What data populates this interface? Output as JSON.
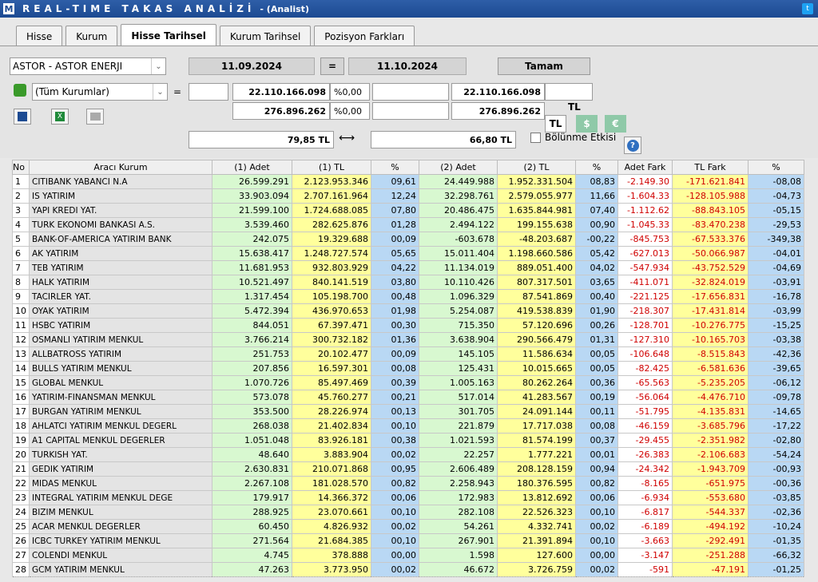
{
  "app": {
    "logo": "M",
    "title": "REAL-TIME TAKAS ANALİZİ",
    "subtitle": "- (Analist)"
  },
  "tabs": [
    "Hisse",
    "Kurum",
    "Hisse Tarihsel",
    "Kurum Tarihsel",
    "Pozisyon Farkları"
  ],
  "controls": {
    "stock": "ASTOR - ASTOR ENERJI",
    "date_start": "11.09.2024",
    "equals": "=",
    "date_end": "11.10.2024",
    "ok_button": "Tamam",
    "institution": "(Tüm Kurumlar)",
    "eq2": "=",
    "total1": "22.110.166.098",
    "pct1": "%0,00",
    "total2": "22.110.166.098",
    "lot1": "276.896.262",
    "pct2": "%0,00",
    "lot2": "276.896.262",
    "tl_label": "TL",
    "cur_tl": "TL",
    "cur_usd": "$",
    "cur_eur": "€",
    "price1": "79,85 TL",
    "arrow": "⟷",
    "price2": "66,80 TL",
    "split_label": "Bölünme Etkisi",
    "help": "?"
  },
  "colors": {
    "titlebar": "#1c4a92",
    "green": "#d8f8d0",
    "yellow": "#ffff9c",
    "blue": "#b9d8f4",
    "negative": "#d00000"
  },
  "table": {
    "headers": [
      "No",
      "Aracı Kurum",
      "(1) Adet",
      "(1) TL",
      "%",
      "(2) Adet",
      "(2) TL",
      "%",
      "Adet Fark",
      "TL Fark",
      "%"
    ],
    "rows": [
      [
        "1",
        "CITIBANK YABANCI N.A",
        "26.599.291",
        "2.123.953.346",
        "09,61",
        "24.449.988",
        "1.952.331.504",
        "08,83",
        "-2.149.30",
        "-171.621.841",
        "-08,08"
      ],
      [
        "2",
        "IS YATIRIM",
        "33.903.094",
        "2.707.161.964",
        "12,24",
        "32.298.761",
        "2.579.055.977",
        "11,66",
        "-1.604.33",
        "-128.105.988",
        "-04,73"
      ],
      [
        "3",
        "YAPI KREDI YAT.",
        "21.599.100",
        "1.724.688.085",
        "07,80",
        "20.486.475",
        "1.635.844.981",
        "07,40",
        "-1.112.62",
        "-88.843.105",
        "-05,15"
      ],
      [
        "4",
        "TURK EKONOMI BANKASI A.S.",
        "3.539.460",
        "282.625.876",
        "01,28",
        "2.494.122",
        "199.155.638",
        "00,90",
        "-1.045.33",
        "-83.470.238",
        "-29,53"
      ],
      [
        "5",
        "BANK-OF-AMERICA YATIRIM BANK",
        "242.075",
        "19.329.688",
        "00,09",
        "-603.678",
        "-48.203.687",
        "-00,22",
        "-845.753",
        "-67.533.376",
        "-349,38"
      ],
      [
        "6",
        "AK YATIRIM",
        "15.638.417",
        "1.248.727.574",
        "05,65",
        "15.011.404",
        "1.198.660.586",
        "05,42",
        "-627.013",
        "-50.066.987",
        "-04,01"
      ],
      [
        "7",
        "TEB YATIRIM",
        "11.681.953",
        "932.803.929",
        "04,22",
        "11.134.019",
        "889.051.400",
        "04,02",
        "-547.934",
        "-43.752.529",
        "-04,69"
      ],
      [
        "8",
        "HALK YATIRIM",
        "10.521.497",
        "840.141.519",
        "03,80",
        "10.110.426",
        "807.317.501",
        "03,65",
        "-411.071",
        "-32.824.019",
        "-03,91"
      ],
      [
        "9",
        "TACIRLER YAT.",
        "1.317.454",
        "105.198.700",
        "00,48",
        "1.096.329",
        "87.541.869",
        "00,40",
        "-221.125",
        "-17.656.831",
        "-16,78"
      ],
      [
        "10",
        "OYAK YATIRIM",
        "5.472.394",
        "436.970.653",
        "01,98",
        "5.254.087",
        "419.538.839",
        "01,90",
        "-218.307",
        "-17.431.814",
        "-03,99"
      ],
      [
        "11",
        "HSBC YATIRIM",
        "844.051",
        "67.397.471",
        "00,30",
        "715.350",
        "57.120.696",
        "00,26",
        "-128.701",
        "-10.276.775",
        "-15,25"
      ],
      [
        "12",
        "OSMANLI YATIRIM MENKUL",
        "3.766.214",
        "300.732.182",
        "01,36",
        "3.638.904",
        "290.566.479",
        "01,31",
        "-127.310",
        "-10.165.703",
        "-03,38"
      ],
      [
        "13",
        "ALLBATROSS YATIRIM",
        "251.753",
        "20.102.477",
        "00,09",
        "145.105",
        "11.586.634",
        "00,05",
        "-106.648",
        "-8.515.843",
        "-42,36"
      ],
      [
        "14",
        "BULLS YATIRIM MENKUL",
        "207.856",
        "16.597.301",
        "00,08",
        "125.431",
        "10.015.665",
        "00,05",
        "-82.425",
        "-6.581.636",
        "-39,65"
      ],
      [
        "15",
        "GLOBAL MENKUL",
        "1.070.726",
        "85.497.469",
        "00,39",
        "1.005.163",
        "80.262.264",
        "00,36",
        "-65.563",
        "-5.235.205",
        "-06,12"
      ],
      [
        "16",
        "YATIRIM-FINANSMAN MENKUL",
        "573.078",
        "45.760.277",
        "00,21",
        "517.014",
        "41.283.567",
        "00,19",
        "-56.064",
        "-4.476.710",
        "-09,78"
      ],
      [
        "17",
        "BURGAN YATIRIM MENKUL",
        "353.500",
        "28.226.974",
        "00,13",
        "301.705",
        "24.091.144",
        "00,11",
        "-51.795",
        "-4.135.831",
        "-14,65"
      ],
      [
        "18",
        "AHLATCI YATIRIM MENKUL DEGERL",
        "268.038",
        "21.402.834",
        "00,10",
        "221.879",
        "17.717.038",
        "00,08",
        "-46.159",
        "-3.685.796",
        "-17,22"
      ],
      [
        "19",
        "A1 CAPITAL MENKUL DEGERLER",
        "1.051.048",
        "83.926.181",
        "00,38",
        "1.021.593",
        "81.574.199",
        "00,37",
        "-29.455",
        "-2.351.982",
        "-02,80"
      ],
      [
        "20",
        "TURKISH YAT.",
        "48.640",
        "3.883.904",
        "00,02",
        "22.257",
        "1.777.221",
        "00,01",
        "-26.383",
        "-2.106.683",
        "-54,24"
      ],
      [
        "21",
        "GEDIK YATIRIM",
        "2.630.831",
        "210.071.868",
        "00,95",
        "2.606.489",
        "208.128.159",
        "00,94",
        "-24.342",
        "-1.943.709",
        "-00,93"
      ],
      [
        "22",
        "MIDAS MENKUL",
        "2.267.108",
        "181.028.570",
        "00,82",
        "2.258.943",
        "180.376.595",
        "00,82",
        "-8.165",
        "-651.975",
        "-00,36"
      ],
      [
        "23",
        "INTEGRAL YATIRIM MENKUL DEGE",
        "179.917",
        "14.366.372",
        "00,06",
        "172.983",
        "13.812.692",
        "00,06",
        "-6.934",
        "-553.680",
        "-03,85"
      ],
      [
        "24",
        "BIZIM MENKUL",
        "288.925",
        "23.070.661",
        "00,10",
        "282.108",
        "22.526.323",
        "00,10",
        "-6.817",
        "-544.337",
        "-02,36"
      ],
      [
        "25",
        "ACAR MENKUL DEGERLER",
        "60.450",
        "4.826.932",
        "00,02",
        "54.261",
        "4.332.741",
        "00,02",
        "-6.189",
        "-494.192",
        "-10,24"
      ],
      [
        "26",
        "ICBC TURKEY YATIRIM MENKUL",
        "271.564",
        "21.684.385",
        "00,10",
        "267.901",
        "21.391.894",
        "00,10",
        "-3.663",
        "-292.491",
        "-01,35"
      ],
      [
        "27",
        "COLENDI MENKUL",
        "4.745",
        "378.888",
        "00,00",
        "1.598",
        "127.600",
        "00,00",
        "-3.147",
        "-251.288",
        "-66,32"
      ],
      [
        "28",
        "GCM YATIRIM MENKUL",
        "47.263",
        "3.773.950",
        "00,02",
        "46.672",
        "3.726.759",
        "00,02",
        "-591",
        "-47.191",
        "-01,25"
      ]
    ]
  }
}
